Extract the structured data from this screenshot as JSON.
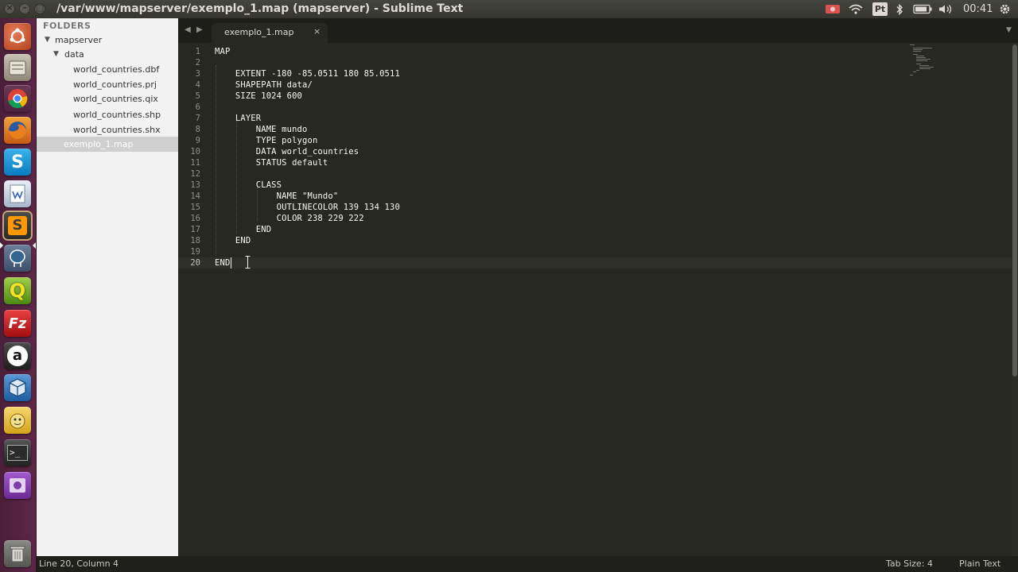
{
  "window": {
    "title": "/var/www/mapserver/exemplo_1.map (mapserver) - Sublime Text",
    "buttons": [
      "×",
      "–",
      "□"
    ]
  },
  "tray": {
    "pt_label": "Pt",
    "time": "00:41",
    "colors": {
      "record": "#d9534f"
    }
  },
  "launcher": {
    "items": [
      {
        "name": "ubuntu-dash-icon",
        "glyph": "◎"
      },
      {
        "name": "files-icon",
        "glyph": "▤"
      },
      {
        "name": "chrome-icon",
        "glyph": "●"
      },
      {
        "name": "firefox-icon",
        "glyph": "◉"
      },
      {
        "name": "skype-icon",
        "glyph": "S"
      },
      {
        "name": "libreoffice-writer-icon",
        "glyph": "W"
      },
      {
        "name": "sublime-text-icon",
        "glyph": "S"
      },
      {
        "name": "pgadmin-icon",
        "glyph": "🐘"
      },
      {
        "name": "qgis-icon",
        "glyph": "Q"
      },
      {
        "name": "filezilla-icon",
        "glyph": "Fz"
      },
      {
        "name": "amazon-icon",
        "glyph": "a"
      },
      {
        "name": "virtualbox-icon",
        "glyph": "⬡"
      },
      {
        "name": "pidgin-icon",
        "glyph": "☺"
      },
      {
        "name": "terminal-icon",
        "glyph": ">_"
      },
      {
        "name": "media-icon",
        "glyph": "▦"
      },
      {
        "name": "trash-icon",
        "glyph": "🗑"
      }
    ]
  },
  "sidebar": {
    "heading": "FOLDERS",
    "tree": [
      {
        "label": "mapserver",
        "depth": 0,
        "arrow": "▼"
      },
      {
        "label": "data",
        "depth": 1,
        "arrow": "▼"
      },
      {
        "label": "world_countries.dbf",
        "depth": 2
      },
      {
        "label": "world_countries.prj",
        "depth": 2
      },
      {
        "label": "world_countries.qix",
        "depth": 2
      },
      {
        "label": "world_countries.shp",
        "depth": 2
      },
      {
        "label": "world_countries.shx",
        "depth": 2
      },
      {
        "label": "exemplo_1.map",
        "depth": 1,
        "selected": true
      }
    ]
  },
  "tabs": {
    "active_label": "exemplo_1.map",
    "close_glyph": "×",
    "nav_left": "◀",
    "nav_right": "▶",
    "menu": "▼"
  },
  "editor": {
    "lines": [
      "MAP",
      "",
      "    EXTENT -180 -85.0511 180 85.0511",
      "    SHAPEPATH data/",
      "    SIZE 1024 600",
      "",
      "    LAYER",
      "        NAME mundo",
      "        TYPE polygon",
      "        DATA world_countries",
      "        STATUS default",
      "",
      "        CLASS",
      "            NAME \"Mundo\"",
      "            OUTLINECOLOR 139 134 130",
      "            COLOR 238 229 222",
      "        END",
      "    END",
      "",
      "END"
    ],
    "current_line": 20
  },
  "status": {
    "position": "Line 20, Column 4",
    "tab_size": "Tab Size: 4",
    "syntax": "Plain Text"
  }
}
